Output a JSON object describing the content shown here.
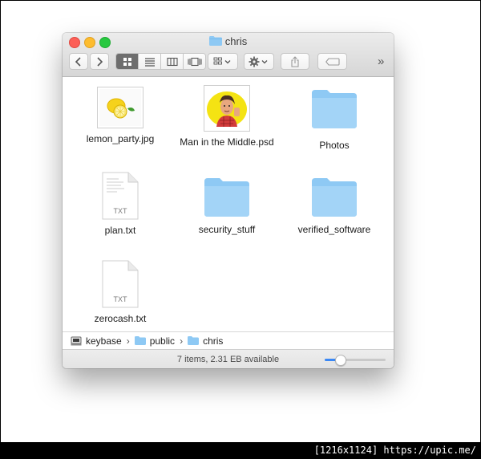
{
  "window": {
    "title": "chris"
  },
  "toolbar": {
    "back_icon": "chevron-left",
    "forward_icon": "chevron-right",
    "view_modes": [
      "icon-view",
      "list-view",
      "column-view",
      "cover-flow-view"
    ],
    "active_view": "icon-view",
    "arrange_icon": "arrange-grid-icon",
    "action_icon": "gear-icon",
    "share_icon": "share-icon",
    "tags_icon": "tag-icon",
    "overflow_label": "»"
  },
  "files": [
    {
      "name": "lemon_party.jpg",
      "kind": "image-lemon"
    },
    {
      "name": "Man in the Middle.psd",
      "kind": "image-psd"
    },
    {
      "name": "Photos",
      "kind": "folder"
    },
    {
      "name": "plan.txt",
      "kind": "txt",
      "ext": "TXT"
    },
    {
      "name": "security_stuff",
      "kind": "folder"
    },
    {
      "name": "verified_software",
      "kind": "folder"
    },
    {
      "name": "zerocash.txt",
      "kind": "txt",
      "ext": "TXT"
    }
  ],
  "pathbar": {
    "crumbs": [
      "keybase",
      "public",
      "chris"
    ]
  },
  "status": {
    "text": "7 items, 2.31 EB available",
    "icon_size_level": 0.25
  },
  "watermark": "[1216x1124] https://upic.me/",
  "colors": {
    "folder_blue": "#8ec9f4",
    "accent": "#3b88f5"
  }
}
